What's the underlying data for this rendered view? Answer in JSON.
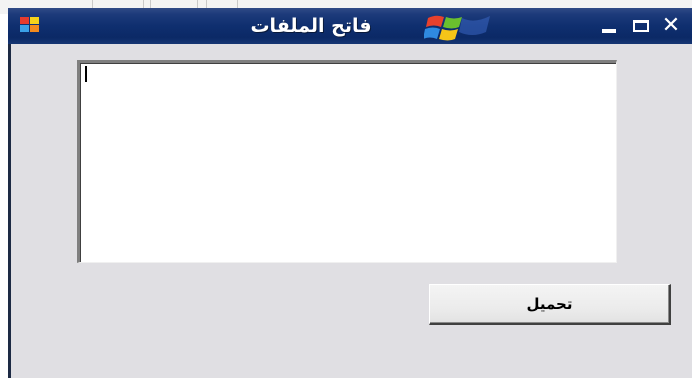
{
  "window": {
    "title": "فاتح الملفات",
    "app_icon": "app-window-icon",
    "logo": "windows-flag-logo",
    "controls": {
      "minimize_icon": "minimize-icon",
      "maximize_icon": "maximize-icon",
      "close_icon": "close-icon",
      "close_glyph": "✕"
    }
  },
  "editor": {
    "value": ""
  },
  "actions": {
    "load_label": "تحميل"
  },
  "colors": {
    "titlebar": "#0f2f6f",
    "client_area": "#e0dfe3",
    "memo_background": "#ffffff",
    "button_face": "#ececec"
  }
}
